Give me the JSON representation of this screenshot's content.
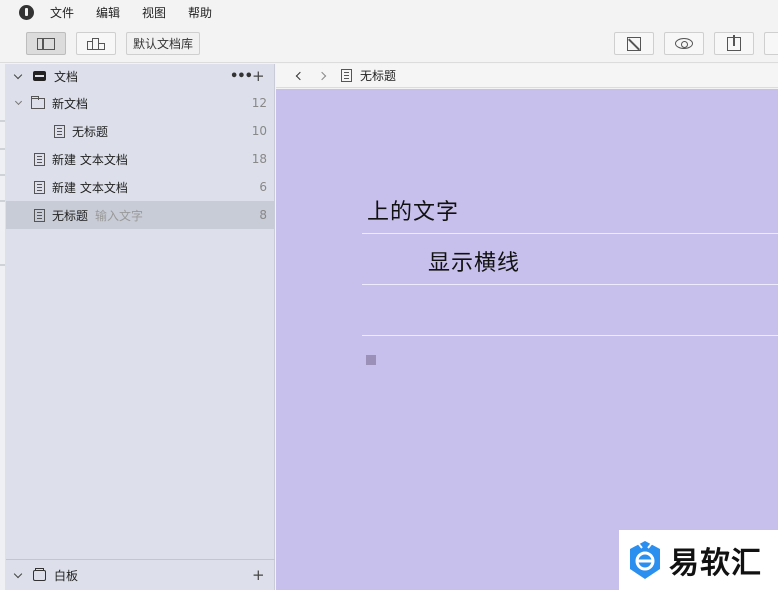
{
  "menu": {
    "items": [
      "文件",
      "编辑",
      "视图",
      "帮助"
    ]
  },
  "toolbar": {
    "library_label": "默认文档库",
    "icons": [
      "sidebar-toggle-icon",
      "whiteboard-icon",
      "expand-icon",
      "preview-eye-icon",
      "export-icon"
    ]
  },
  "sidebar": {
    "header_title": "文档",
    "more_label": "•••",
    "add_label": "+",
    "items": [
      {
        "label": "新文档",
        "count": "12",
        "icon": "folder-icon",
        "expandable": true
      },
      {
        "label": "无标题",
        "count": "10",
        "icon": "document-icon",
        "nested": true
      },
      {
        "label": "新建 文本文档",
        "count": "18",
        "icon": "document-icon"
      },
      {
        "label": "新建 文本文档",
        "count": "6",
        "icon": "document-icon"
      },
      {
        "label": "无标题",
        "sub": "输入文字",
        "count": "8",
        "icon": "document-icon",
        "selected": true
      }
    ],
    "footer_title": "白板",
    "footer_add": "+"
  },
  "editor": {
    "breadcrumb_title": "无标题",
    "line1": "上的文字",
    "line2": "显示横线",
    "background": "#c8c0ec"
  },
  "watermark": {
    "text": "易软汇",
    "brand_color": "#2b8ff0"
  }
}
